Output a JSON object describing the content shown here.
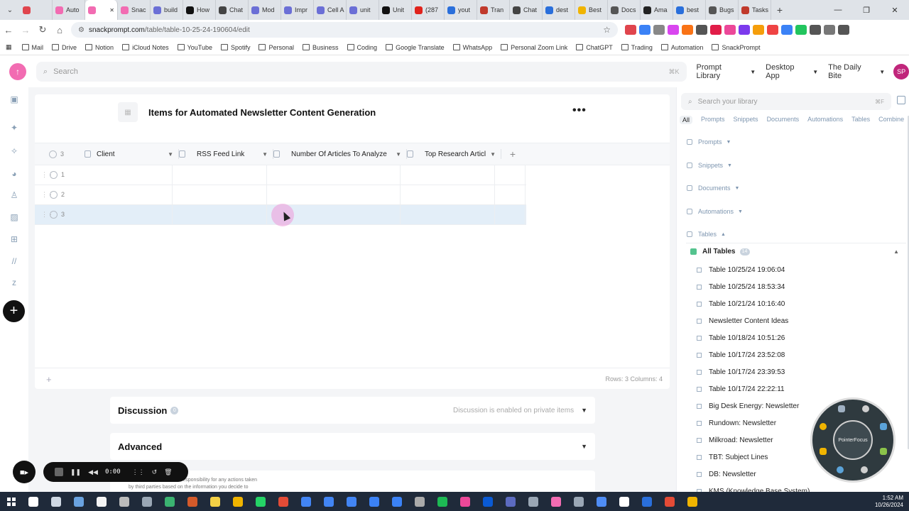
{
  "browser": {
    "tabs": [
      {
        "label": "",
        "color": "#e0454d"
      },
      {
        "label": "Auto",
        "color": "#f26cb2"
      },
      {
        "label": "",
        "color": "#f26cb2",
        "active": true
      },
      {
        "label": "Snac",
        "color": "#f26cb2"
      },
      {
        "label": "build",
        "color": "#6b6fd6"
      },
      {
        "label": "How",
        "color": "#111111"
      },
      {
        "label": "Chat",
        "color": "#444444"
      },
      {
        "label": "Mod",
        "color": "#6b6fd6"
      },
      {
        "label": "Impr",
        "color": "#6b6fd6"
      },
      {
        "label": "Cell A",
        "color": "#6b6fd6"
      },
      {
        "label": "unit",
        "color": "#6b6fd6"
      },
      {
        "label": "Unit",
        "color": "#111111"
      },
      {
        "label": "(287",
        "color": "#e0231c"
      },
      {
        "label": "yout",
        "color": "#2a6fdb"
      },
      {
        "label": "Tran",
        "color": "#c0392b"
      },
      {
        "label": "Chat",
        "color": "#444444"
      },
      {
        "label": "dest",
        "color": "#2a6fdb"
      },
      {
        "label": "Best",
        "color": "#f0b400"
      },
      {
        "label": "Docs",
        "color": "#555555"
      },
      {
        "label": "Ama",
        "color": "#222222"
      },
      {
        "label": "best",
        "color": "#2a6fdb"
      },
      {
        "label": "Bugs",
        "color": "#555555"
      },
      {
        "label": "Tasks",
        "color": "#c0392b"
      }
    ],
    "url_host": "snackprompt.com",
    "url_path": "/table/table-10-25-24-190604/edit",
    "extension_colors": [
      "#e0454d",
      "#3b82f6",
      "#888888",
      "#d946ef",
      "#f97316",
      "#555555",
      "#e11d48",
      "#ec4899",
      "#7c3aed",
      "#f59e0b",
      "#ef4444",
      "#3b82f6",
      "#22c55e",
      "#555555",
      "#777777",
      "#555555"
    ],
    "bookmarks": [
      "Mail",
      "Drive",
      "Notion",
      "iCloud Notes",
      "YouTube",
      "Spotify",
      "Personal",
      "Business",
      "Coding",
      "Google Translate",
      "WhatsApp",
      "Personal Zoom Link",
      "ChatGPT",
      "Trading",
      "Automation",
      "SnackPrompt"
    ]
  },
  "app": {
    "search_placeholder": "Search",
    "search_shortcut": "⌘K",
    "menus": [
      "Prompt Library",
      "Desktop App",
      "The Daily Bite"
    ],
    "avatar_initials": "SP",
    "accent_color": "#f26cb2"
  },
  "table": {
    "title": "Items for Automated Newsletter Content Generation",
    "selected_count": "3",
    "columns": [
      "Client",
      "RSS Feed Link",
      "Number Of Articles To Analyze",
      "Top Research Articl"
    ],
    "rows": [
      "1",
      "2",
      "3"
    ],
    "selected_row": "3",
    "footer_stats": "Rows: 3  Columns: 4"
  },
  "sections": {
    "discussion_title": "Discussion",
    "discussion_count": "0",
    "discussion_note": "Discussion is enabled on private items",
    "advanced_title": "Advanced",
    "disclaimer_line1": "responsibility for any actions taken",
    "disclaimer_line2": "by third parties based on the information you decide to"
  },
  "library": {
    "search_placeholder": "Search your library",
    "search_shortcut": "⌘F",
    "filters": [
      "All",
      "Prompts",
      "Snippets",
      "Documents",
      "Automations",
      "Tables",
      "Combine"
    ],
    "active_filter": "All",
    "categories": [
      "Prompts",
      "Snippets",
      "Documents",
      "Automations",
      "Tables"
    ],
    "all_tables_label": "All Tables",
    "all_tables_count": "14",
    "tables": [
      "Table 10/25/24 19:06:04",
      "Table 10/25/24 18:53:34",
      "Table 10/21/24 10:16:40",
      "Newsletter Content Ideas",
      "Table 10/18/24 10:51:26",
      "Table 10/17/24 23:52:08",
      "Table 10/17/24 23:39:53",
      "Table 10/17/24 22:22:11",
      "Big Desk Energy: Newsletter",
      "Rundown: Newsletter",
      "Milkroad: Newsletter",
      "TBT: Subject Lines",
      "DB: Newsletter",
      "KMS (Knowledge Base System)"
    ]
  },
  "overlay": {
    "pointerfocus_label": "PointerFocus",
    "recording_time": "0:00"
  },
  "taskbar": {
    "time": "1:52 AM",
    "date": "10/26/2024"
  }
}
